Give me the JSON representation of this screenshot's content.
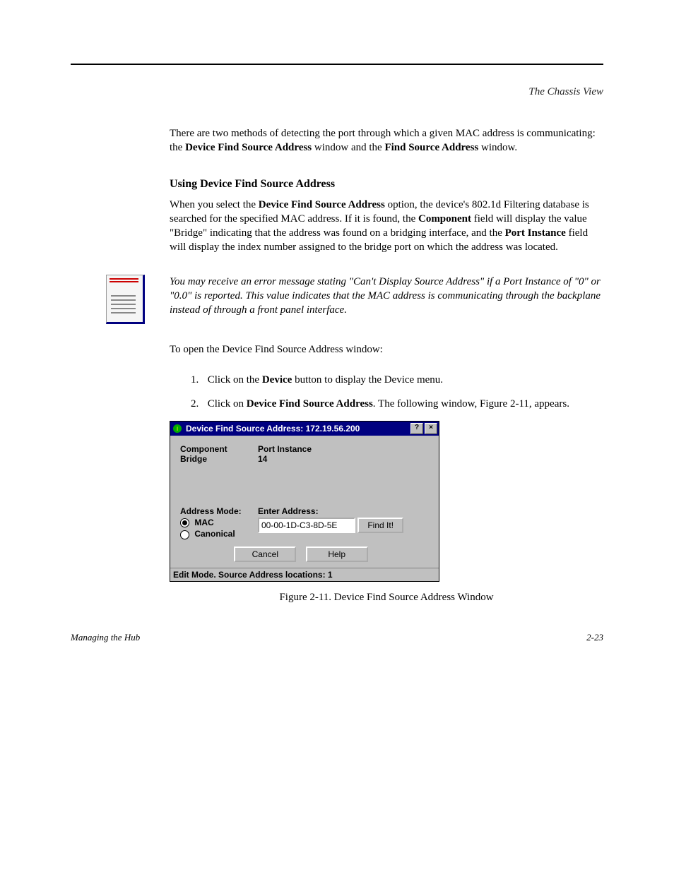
{
  "header": {
    "title": "The Chassis View"
  },
  "para1_pre": "There are two methods of detecting the port through which a given MAC address is communicating: the ",
  "para1_bold1": "Device Find Source Address",
  "para1_mid": " window and the ",
  "para1_bold2": "Find Source Address",
  "para1_post": " window.",
  "subheading": "Using Device Find Source Address",
  "para2_pre": "When you select the ",
  "para2_b1": "Device Find Source Address",
  "para2_mid1": " option, the device's 802.1d Filtering database is searched for the specified MAC address. If it is found, the ",
  "para2_b2": "Component",
  "para2_mid2": " field will display the value \"Bridge\" indicating that the address was found on a bridging interface, and the ",
  "para2_b3": "Port Instance",
  "para2_post": " field will display the index number assigned to the bridge port on which the address was located.",
  "note": "You may receive an error message stating \"Can't Display Source Address\" if a Port Instance of \"0\" or \"0.0\" is reported. This value indicates that the MAC address is communicating through the backplane instead of through a front panel interface.",
  "instruction": "To open the Device Find Source Address window:",
  "steps": [
    {
      "n": "1.",
      "pre": "Click on the ",
      "b": "Device",
      "post": " button to display the Device menu."
    },
    {
      "n": "2.",
      "pre": "Click on ",
      "b": "Device Find Source Address",
      "post": ". The following window, Figure 2-11, appears."
    }
  ],
  "dialog": {
    "title": "Device Find Source Address:  172.19.56.200",
    "help_btn": "?",
    "close_btn": "×",
    "col_component": "Component",
    "col_portinstance": "Port Instance",
    "val_component": "Bridge",
    "val_portinstance": "14",
    "address_mode_label": "Address Mode:",
    "enter_address_label": "Enter Address:",
    "radio_mac": "MAC",
    "radio_canonical": "Canonical",
    "address_value": "00-00-1D-C3-8D-5E",
    "find_btn": "Find It!",
    "cancel_btn": "Cancel",
    "dlg_help_btn": "Help",
    "status": "Edit Mode. Source Address locations: 1"
  },
  "caption": "Figure 2-11.  Device Find Source Address Window",
  "footer": {
    "left": "Managing the Hub",
    "right": "2-23"
  }
}
